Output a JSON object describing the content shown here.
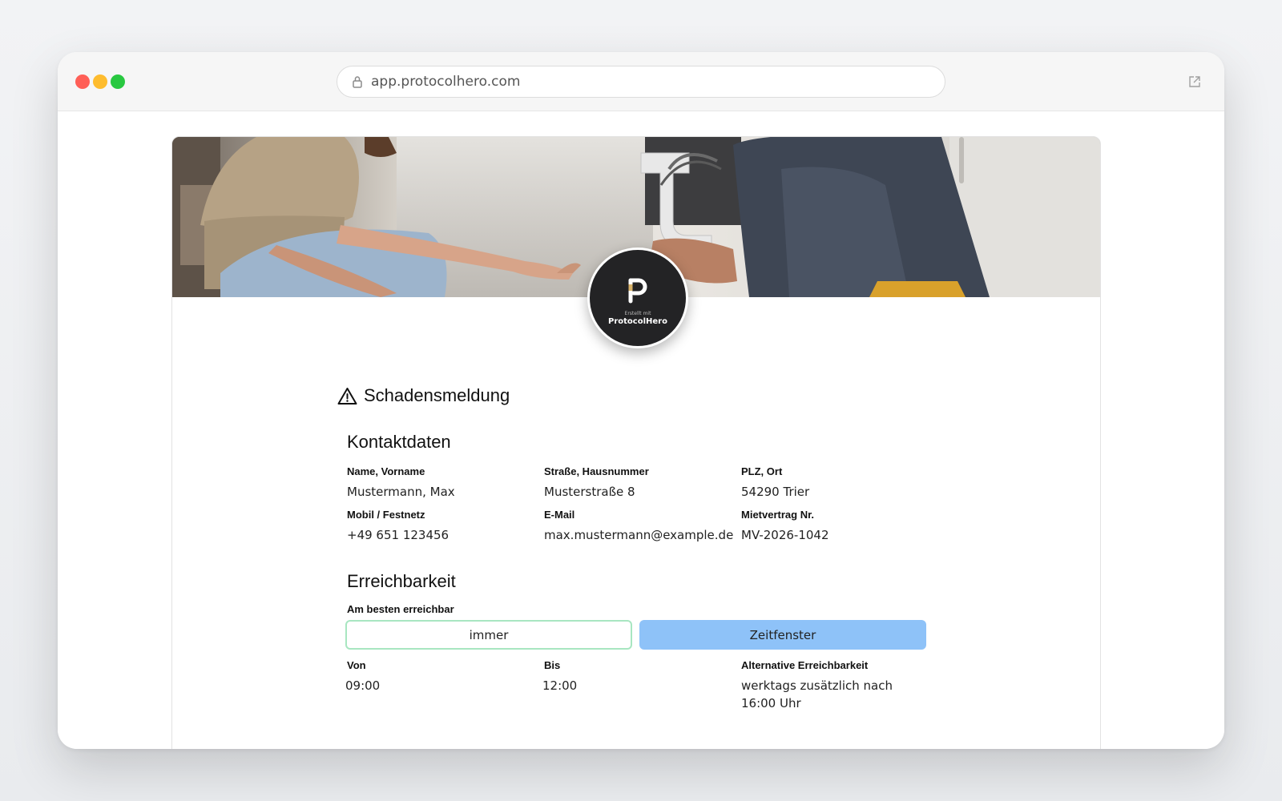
{
  "browser": {
    "url": "app.protocolhero.com",
    "lock_icon": "lock-icon",
    "external_icon": "external-link-icon"
  },
  "logo": {
    "small_text": "Erstellt mit",
    "name": "ProtocolHero"
  },
  "form": {
    "title": "Schadensmeldung",
    "title_icon": "warning-triangle-icon",
    "contact": {
      "heading": "Kontaktdaten",
      "fields": [
        {
          "label": "Name, Vorname",
          "value": "Mustermann, Max"
        },
        {
          "label": "Straße, Hausnummer",
          "value": "Musterstraße 8"
        },
        {
          "label": "PLZ, Ort",
          "value": "54290 Trier"
        },
        {
          "label": "Mobil / Festnetz",
          "value": "+49 651 123456"
        },
        {
          "label": "E-Mail",
          "value": "max.mustermann@example.de"
        },
        {
          "label": "Mietvertrag Nr.",
          "value": "MV-2026-1042"
        }
      ]
    },
    "reachability": {
      "heading": "Erreichbarkeit",
      "label": "Am besten erreichbar",
      "option_always": "immer",
      "option_window": "Zeitfenster",
      "selected": "Zeitfenster",
      "fields": [
        {
          "label": "Von",
          "value": "09:00"
        },
        {
          "label": "Bis",
          "value": "12:00"
        },
        {
          "label": "Alternative Erreichbarkeit",
          "value": "werktags zusätzlich nach 16:00 Uhr"
        }
      ]
    }
  },
  "colors": {
    "selected_option": "#8ec2f8",
    "unselected_border": "#a8e6c1",
    "logo_background": "#232325"
  }
}
